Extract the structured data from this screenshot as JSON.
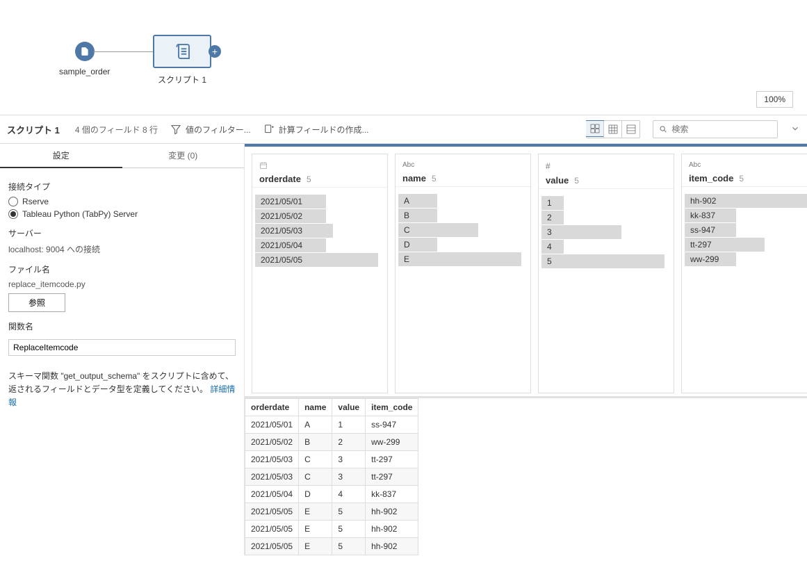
{
  "flow": {
    "node1_label": "sample_order",
    "node2_label": "スクリプト 1",
    "plus": "+",
    "zoom": "100%"
  },
  "toolbar": {
    "title": "スクリプト 1",
    "subtitle": "4 個のフィールド  8 行",
    "filter_label": "値のフィルター...",
    "calc_label": "計算フィールドの作成...",
    "search_placeholder": "検索"
  },
  "side": {
    "tab_settings": "設定",
    "tab_changes": "変更 (0)",
    "conn_type_label": "接続タイプ",
    "radio_rserve": "Rserve",
    "radio_tabpy": "Tableau Python (TabPy) Server",
    "server_label": "サーバー",
    "server_value": "localhost: 9004 への接続",
    "file_label": "ファイル名",
    "file_value": "replace_itemcode.py",
    "browse_btn": "参照",
    "func_label": "関数名",
    "func_value": "ReplaceItemcode",
    "schema_note_1": "スキーマ関数 \"get_output_schema\" をスクリプトに含めて、返されるフィールドとデータ型を定義してください。 ",
    "schema_link": "詳細情報"
  },
  "fields": [
    {
      "name": "orderdate",
      "type": "date",
      "count": "5",
      "values": [
        "2021/05/01",
        "2021/05/02",
        "2021/05/03",
        "2021/05/04",
        "2021/05/05"
      ],
      "widths": [
        55,
        55,
        60,
        55,
        95
      ]
    },
    {
      "name": "name",
      "type": "text",
      "count": "5",
      "values": [
        "A",
        "B",
        "C",
        "D",
        "E"
      ],
      "widths": [
        30,
        30,
        62,
        30,
        95
      ]
    },
    {
      "name": "value",
      "type": "number",
      "count": "5",
      "values": [
        "1",
        "2",
        "3",
        "4",
        "5"
      ],
      "widths": [
        17,
        17,
        62,
        17,
        95
      ]
    },
    {
      "name": "item_code",
      "type": "text",
      "count": "5",
      "values": [
        "hh-902",
        "kk-837",
        "ss-947",
        "tt-297",
        "ww-299"
      ],
      "widths": [
        95,
        40,
        40,
        62,
        40
      ]
    }
  ],
  "grid": {
    "headers": [
      "orderdate",
      "name",
      "value",
      "item_code"
    ],
    "rows": [
      [
        "2021/05/01",
        "A",
        "1",
        "ss-947"
      ],
      [
        "2021/05/02",
        "B",
        "2",
        "ww-299"
      ],
      [
        "2021/05/03",
        "C",
        "3",
        "tt-297"
      ],
      [
        "2021/05/03",
        "C",
        "3",
        "tt-297"
      ],
      [
        "2021/05/04",
        "D",
        "4",
        "kk-837"
      ],
      [
        "2021/05/05",
        "E",
        "5",
        "hh-902"
      ],
      [
        "2021/05/05",
        "E",
        "5",
        "hh-902"
      ],
      [
        "2021/05/05",
        "E",
        "5",
        "hh-902"
      ]
    ]
  }
}
